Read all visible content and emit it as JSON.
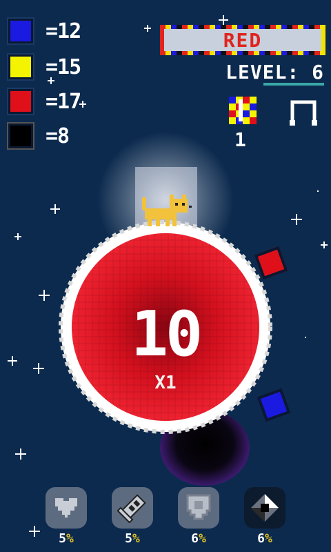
{
  "color_counts": [
    {
      "color": "#1a1ae0",
      "label": "=12"
    },
    {
      "color": "#f4f400",
      "label": "=15"
    },
    {
      "color": "#e0101a",
      "label": "=17"
    },
    {
      "color": "#000000",
      "label": "=8"
    }
  ],
  "target_color": {
    "label": "RED",
    "text_color": "#e0241e"
  },
  "level": {
    "label": "LEVEL: 6"
  },
  "combo": {
    "count": "1",
    "icon": "color-combo-icon"
  },
  "music": {
    "icon": "music-note-icon"
  },
  "planet": {
    "score": "10",
    "multiplier": "X1",
    "color": "#e01020"
  },
  "falling_blocks": [
    {
      "color": "#e0101a"
    },
    {
      "color": "#1a1ae0"
    }
  ],
  "powerups": [
    {
      "icon": "heart-icon",
      "percent": "5",
      "unit": "%"
    },
    {
      "icon": "rocket-icon",
      "percent": "5",
      "unit": "%"
    },
    {
      "icon": "shield-icon",
      "percent": "6",
      "unit": "%"
    },
    {
      "icon": "bomb-icon",
      "percent": "6",
      "unit": "%"
    }
  ]
}
